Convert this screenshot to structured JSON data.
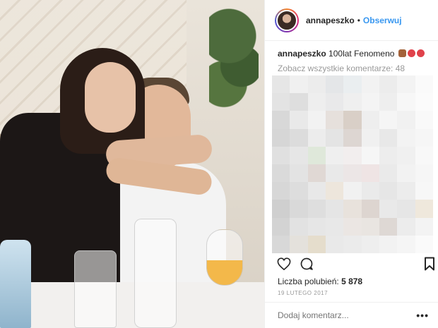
{
  "post": {
    "photo_alt": "",
    "author": {
      "username": "annapeszko",
      "follow_label": "Obserwuj",
      "separator": "•"
    },
    "caption": {
      "username": "annapeszko",
      "text": "100lat Fenomeno",
      "emojis": [
        "cake",
        "lollipop",
        "lollipop"
      ]
    },
    "view_comments_label": "Zobacz wszystkie komentarze: 48",
    "likes_label": "Liczba polubień:",
    "likes_count": "5 878",
    "date": "19 LUTEGO 2017",
    "comment_placeholder": "Dodaj komentarz...",
    "more_label": "•••",
    "colors": {
      "accent": "#3897f0",
      "text": "#262626",
      "muted": "#999999",
      "border": "#efefef"
    },
    "icons": [
      "heart-icon",
      "comment-icon",
      "bookmark-icon"
    ]
  },
  "mosaic_colors": [
    "#e6e6e6",
    "#f0f0f0",
    "#ececec",
    "#e4e6e8",
    "#eaeef0",
    "#f2f2f2",
    "#ececec",
    "#f3f3f3",
    "#fafafa",
    "#e3e3e3",
    "#dedede",
    "#eeeeee",
    "#e9e9ea",
    "#efefef",
    "#f4f4f4",
    "#eeeeee",
    "#f7f7f7",
    "#fbfbfb",
    "#d8d8d8",
    "#e9e9e9",
    "#f2f2f2",
    "#e6e0dc",
    "#d9cfc7",
    "#eeeeee",
    "#f5f5f5",
    "#f1f1f1",
    "#f9f9f9",
    "#d6d6d6",
    "#dcdcdc",
    "#ececec",
    "#e4e4e4",
    "#ddd6d2",
    "#f0f0f0",
    "#e8e8e8",
    "#f3f3f3",
    "#f6f6f6",
    "#e0e0e0",
    "#e6e6e6",
    "#dfe8da",
    "#efefef",
    "#f2eeee",
    "#f6f6f6",
    "#ededed",
    "#f0f0f0",
    "#f8f8f8",
    "#dadada",
    "#e3e3e3",
    "#e0d8d4",
    "#e9e9e9",
    "#ece6e6",
    "#efe4e4",
    "#eaeaea",
    "#f2f2f2",
    "#f6f6f6",
    "#d7d7d7",
    "#dddddd",
    "#e8e8e8",
    "#ede6dc",
    "#f1f1f1",
    "#eaeaea",
    "#e6e6e6",
    "#ececec",
    "#f7f7f7",
    "#cfcfcf",
    "#d9d9d9",
    "#dedede",
    "#e5e5e5",
    "#e8e2dc",
    "#ddd5d0",
    "#e9e9e9",
    "#e6e6e6",
    "#efe8dc",
    "#d3d3d3",
    "#e2e2e2",
    "#e6e6e6",
    "#e8e8e8",
    "#ebe6e3",
    "#e9e5e1",
    "#ded8d4",
    "#ececec",
    "#f3f3f3",
    "#d8d8d8",
    "#e4e1dc",
    "#e5ddcc",
    "#e9e9e9",
    "#ebebeb",
    "#eeeeee",
    "#f2f2f2",
    "#f5f5f5",
    "#fafafa"
  ]
}
